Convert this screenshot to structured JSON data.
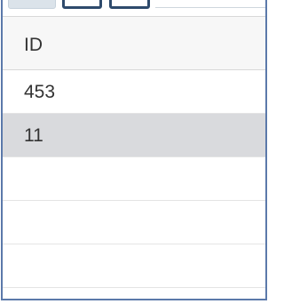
{
  "grid": {
    "columns": [
      {
        "label": "ID"
      }
    ],
    "rows": [
      {
        "id": "453",
        "selected": false
      },
      {
        "id": "11",
        "selected": true
      },
      {
        "id": "",
        "selected": false
      },
      {
        "id": "",
        "selected": false
      },
      {
        "id": "",
        "selected": false
      }
    ]
  }
}
